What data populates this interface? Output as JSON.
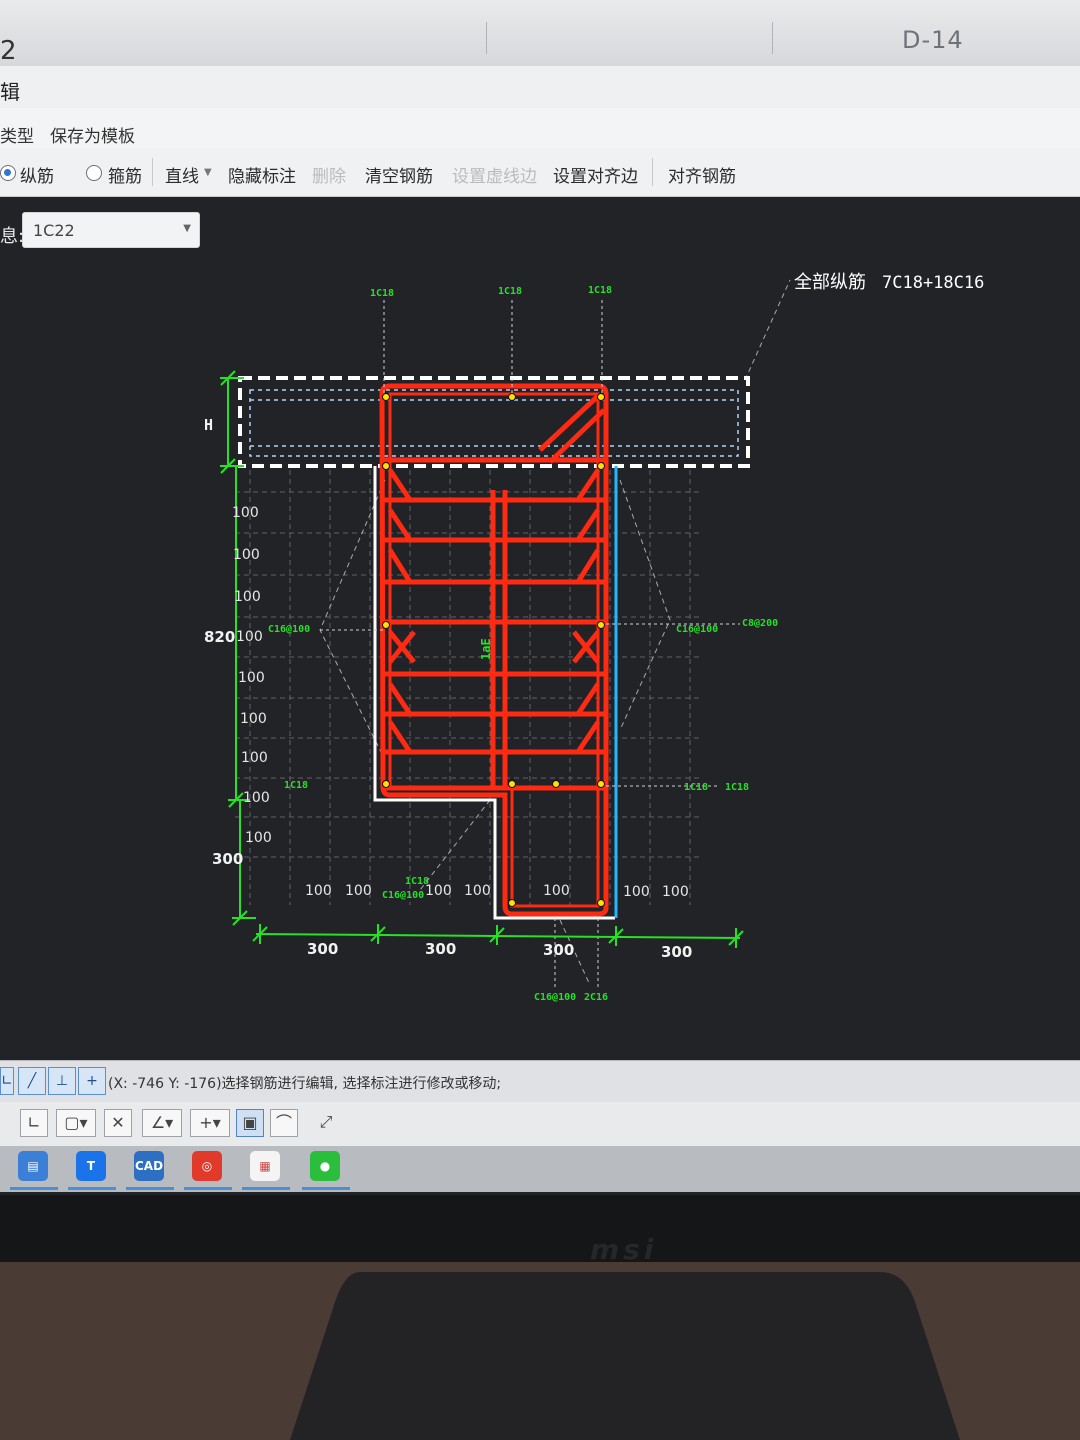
{
  "window": {
    "title_fragment": "2",
    "drawing_id": "D-14"
  },
  "menu": {
    "edit": "辑"
  },
  "toolbar1": {
    "type": "类型",
    "save_template": "保存为模板"
  },
  "toolbar2": {
    "longitudinal": "纵筋",
    "stirrup": "箍筋",
    "line": "直线",
    "hide_annotation": "隐藏标注",
    "delete": "删除",
    "clear_rebar": "清空钢筋",
    "set_dashed_edge": "设置虚线边",
    "set_align_edge": "设置对齐边",
    "align_rebar": "对齐钢筋"
  },
  "info": {
    "label": "息:",
    "rebar_value": "1C22"
  },
  "drawing": {
    "all_long_label": "全部纵筋",
    "all_long_value": "7C18+18C16",
    "h_label": "H",
    "dim_820": "820",
    "dim_300_v": "300",
    "bottom_dims": [
      "300",
      "300",
      "300",
      "300"
    ],
    "spacing_100": "100",
    "top_labels": [
      "1C18",
      "1C18",
      "1C18"
    ],
    "c16_left": "C16@100",
    "c16_right": "C16@100",
    "c8_right": "C8@200",
    "c1c18_left": "1C18",
    "c1c18_right_a": "1C18",
    "c1c18_right_b": "1C18",
    "bottom_mid_1c18": "1C18",
    "bottom_mid_c16": "C16@100",
    "bottom_c16": "C16@100",
    "bottom_2c16": "2C16",
    "vert_lae": "1aE"
  },
  "status": {
    "message": "(X: -746 Y: -176)选择钢筋进行编辑, 选择标注进行修改或移动;"
  },
  "taskbar": {
    "cad_label": "CAD"
  },
  "monitor": {
    "brand": "msi"
  },
  "colors": {
    "rebar": "#ff2a12",
    "dim_green": "#27e027",
    "dashed_white": "#ffffff",
    "cyan_edge": "#22b7ff",
    "canvas_bg": "#222327"
  }
}
